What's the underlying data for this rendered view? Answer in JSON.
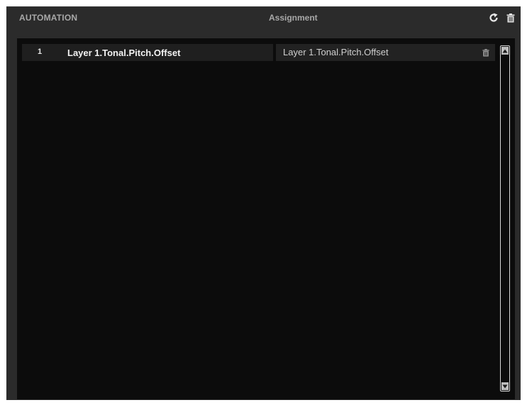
{
  "header": {
    "section_title": "AUTOMATION",
    "column_title": "Assignment",
    "icons": {
      "reload": "reload-icon",
      "delete_all": "trash-icon"
    }
  },
  "list": {
    "rows": [
      {
        "index": "1",
        "parameter": "Layer 1.Tonal.Pitch.Offset",
        "assignment": "Layer 1.Tonal.Pitch.Offset"
      }
    ]
  },
  "colors": {
    "panel_bg": "#2b2b2b",
    "list_bg": "#0c0c0c",
    "header_text": "#a8a8a8",
    "row_text": "#f2f2f2"
  }
}
